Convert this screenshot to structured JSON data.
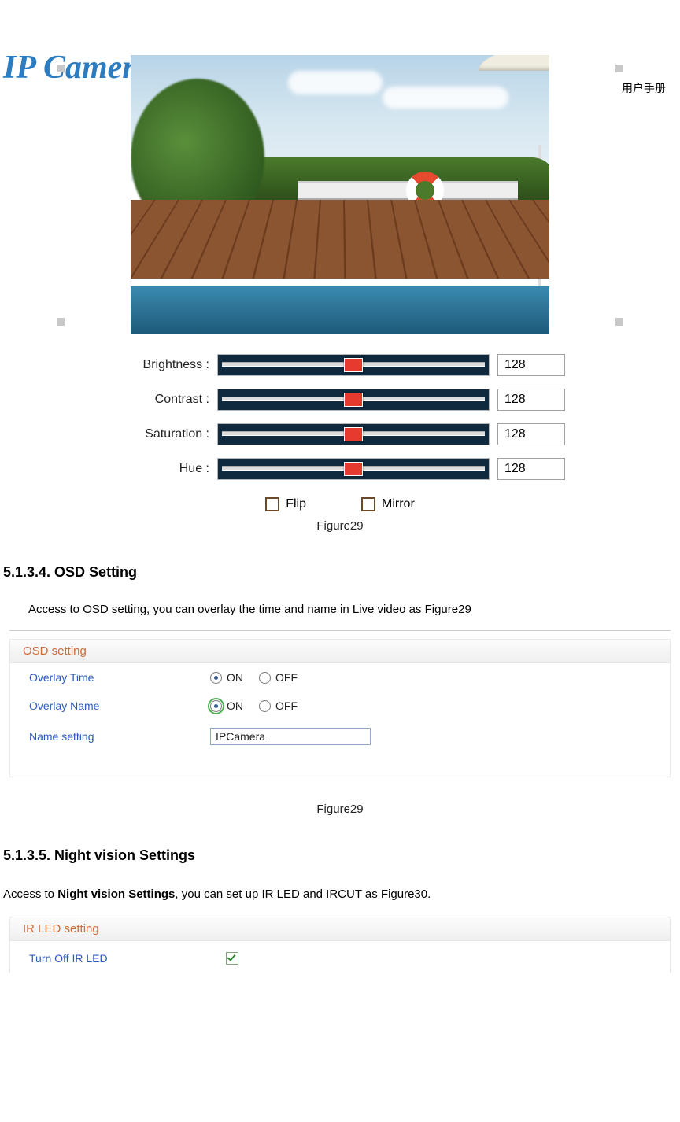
{
  "header": {
    "logo_text": "IP Camera",
    "right_text": "用户手册"
  },
  "figure29_image": {
    "sliders": [
      {
        "label": "Brightness :",
        "value": "128"
      },
      {
        "label": "Contrast :",
        "value": "128"
      },
      {
        "label": "Saturation :",
        "value": "128"
      },
      {
        "label": "Hue :",
        "value": "128"
      }
    ],
    "checkboxes": {
      "flip": {
        "label": "Flip",
        "checked": false
      },
      "mirror": {
        "label": "Mirror",
        "checked": false
      }
    },
    "caption": "Figure29"
  },
  "section_5134": {
    "heading": "5.1.3.4. OSD Setting",
    "body": "Access to OSD setting, you can overlay the time and name in Live video as Figure29"
  },
  "osd_panel": {
    "title": "OSD setting",
    "rows": {
      "overlay_time": {
        "label": "Overlay Time",
        "on": "ON",
        "off": "OFF",
        "selected": "ON"
      },
      "overlay_name": {
        "label": "Overlay Name",
        "on": "ON",
        "off": "OFF",
        "selected": "ON"
      },
      "name_setting": {
        "label": "Name setting",
        "value": "IPCamera"
      }
    },
    "caption": "Figure29"
  },
  "section_5135": {
    "heading": "5.1.3.5. Night vision Settings",
    "body_prefix": "Access to ",
    "body_bold": "Night vision Settings",
    "body_suffix": ", you can set up IR LED and IRCUT as Figure30."
  },
  "ir_panel": {
    "title": "IR LED setting",
    "turn_off_label": "Turn Off IR LED",
    "turn_off_checked": true
  }
}
